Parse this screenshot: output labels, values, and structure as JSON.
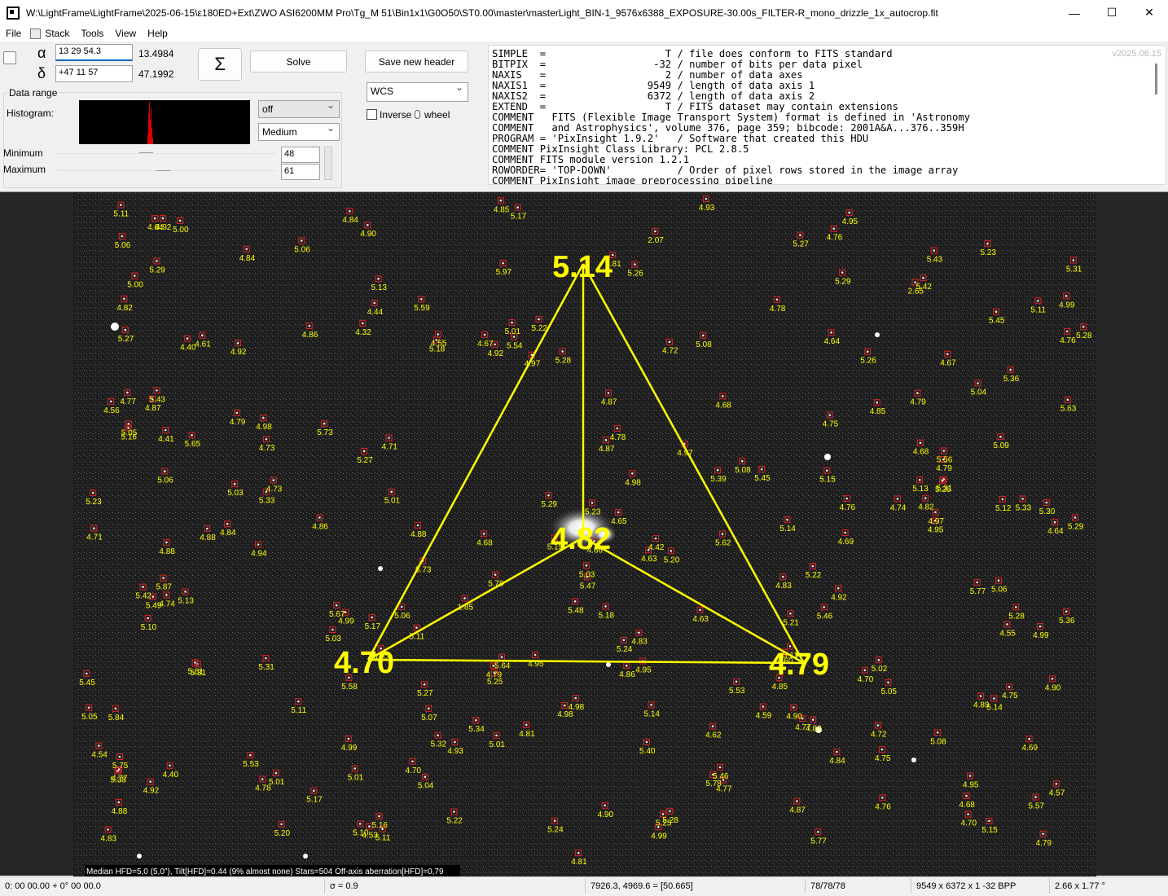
{
  "window": {
    "title": "W:\\LightFrame\\LightFrame\\2025-06-15\\ε180ED+Ext\\ZWO ASI6200MM Pro\\Tg_M 51\\Bin1x1\\G0O50\\ST0.00\\master\\masterLight_BIN-1_9576x6388_EXPOSURE-30.00s_FILTER-R_mono_drizzle_1x_autocrop.fit",
    "minimize": "—",
    "maximize": "☐",
    "close": "✕"
  },
  "menu": {
    "file": "File",
    "stack": "Stack",
    "tools": "Tools",
    "view": "View",
    "help": "Help"
  },
  "coords": {
    "alpha_symbol": "α",
    "delta_symbol": "δ",
    "ra_input": "13 29 54.3",
    "dec_input": "+47 11 57",
    "ra_decimal": "13.4984",
    "dec_decimal": "47.1992"
  },
  "buttons": {
    "sigma": "Σ",
    "solve": "Solve",
    "save_header": "Save new header"
  },
  "wcs_select": "WCS",
  "inverse_label": "Inverse",
  "wheel_label": "wheel",
  "data_range": {
    "group_label": "Data range",
    "histogram_label": "Histogram:",
    "stretch_select": "off",
    "level_select": "Medium",
    "minimum_label": "Minimum",
    "maximum_label": "Maximum",
    "minimum_value": "48",
    "maximum_value": "61"
  },
  "version": "v2025.06.15",
  "header_lines": [
    "SIMPLE  =                    T / file does conform to FITS standard",
    "BITPIX  =                  -32 / number of bits per data pixel",
    "NAXIS   =                    2 / number of data axes",
    "NAXIS1  =                 9549 / length of data axis 1",
    "NAXIS2  =                 6372 / length of data axis 2",
    "EXTEND  =                    T / FITS dataset may contain extensions",
    "COMMENT   FITS (Flexible Image Transport System) format is defined in 'Astronomy",
    "COMMENT   and Astrophysics', volume 376, page 359; bibcode: 2001A&A...376..359H",
    "PROGRAM = 'PixInsight 1.9.2'   / Software that created this HDU",
    "COMMENT PixInsight Class Library: PCL 2.8.5",
    "COMMENT FITS module version 1.2.1",
    "ROWORDER= 'TOP-DOWN'           / Order of pixel rows stored in the image array",
    "COMMENT PixInsight image preprocessing pipeline"
  ],
  "tilt": {
    "top": "5.14",
    "center": "4.82",
    "left": "4.70",
    "right": "4.79"
  },
  "hfd_labels": [
    "5.73",
    "5.31",
    "5.43",
    "5.32",
    "5.28",
    "5.30",
    "5.15",
    "5.17",
    "5.53",
    "5.06",
    "5.81",
    "5.84",
    "5.62",
    "5.63",
    "5.77",
    "5.48",
    "5.36",
    "5.49",
    "5.61",
    "5.56",
    "5.45",
    "5.42",
    "5.57",
    "5.46",
    "5.28",
    "5.20",
    "5.04",
    "5.36",
    "5.13",
    "5.14",
    "4.99",
    "5.13",
    "5.47",
    "5.64",
    "5.65",
    "5.78",
    "5.53",
    "5.58",
    "5.25",
    "5.31",
    "5.46",
    "5.33",
    "5.29",
    "5.26",
    "5.27",
    "5.13",
    "5.07",
    "5.38",
    "5.33",
    "5.18",
    "5.26",
    "5.23",
    "5.14",
    "5.08",
    "5.26",
    "5.27",
    "5.25",
    "5.05",
    "5.29",
    "5.16",
    "5.31",
    "4.98",
    "5.59",
    "5.11",
    "5.67",
    "4.88",
    "5.28",
    "5.24",
    "5.22",
    "5.01",
    "4.93",
    "5.15",
    "4.83",
    "5.06",
    "5.01",
    "4.90",
    "5.05",
    "5.29",
    "5.10",
    "5.28",
    "5.42",
    "5.75",
    "2.65",
    "5.21",
    "5.23",
    "5.34",
    "5.73",
    "5.20",
    "5.03",
    "4.82",
    "4.99",
    "4.98",
    "5.09",
    "5.17",
    "4.85",
    "4.90",
    "4.77",
    "4.81",
    "4.95",
    "4.79",
    "4.87",
    "5.11",
    "4.95",
    "5.06",
    "5.08",
    "5.02",
    "5.11",
    "5.18",
    "5.15",
    "5.14",
    "5.87",
    "5.03",
    "5.16",
    "5.39",
    "5.29",
    "4.64",
    "5.23",
    "4.97",
    "4.99",
    "5.06",
    "4.78",
    "5.00",
    "4.63",
    "5.00",
    "4.95",
    "4.92",
    "5.04",
    "5.01",
    "5.12",
    "5.77",
    "5.10",
    "5.79",
    "4.95",
    "5.22",
    "5.17",
    "5.03",
    "4.83",
    "4.90",
    "4.95",
    "5.11",
    "4.94",
    "4.76",
    "4.89",
    "4.64",
    "4.68",
    "4.77",
    "4.85",
    "4.70",
    "4.92",
    "4.79",
    "5.06",
    "4.88",
    "4.93",
    "4.87",
    "4.75",
    "4.82",
    "4.79",
    "5.24",
    "5.22",
    "4.99",
    "4.78",
    "4.73",
    "4.74",
    "4.72",
    "4.72",
    "4.83",
    "4.40",
    "4.57",
    "4.64",
    "4.90",
    "4.59",
    "5.40",
    "5.11",
    "5.27",
    "4.98",
    "5.08",
    "4.68",
    "4.68",
    "4.92",
    "4.92",
    "4.79",
    "4.65",
    "5.97",
    "4.78",
    "4.88",
    "4.76",
    "4.82",
    "4.99",
    "4.67",
    "4.84",
    "4.32",
    "4.87",
    "4.76",
    "4.66",
    "4.71",
    "4.76",
    "4.53",
    "4.68",
    "4.81",
    "4.69",
    "4.55",
    "4.70",
    "4.74",
    "5.01",
    "4.97",
    "4.86",
    "4.85",
    "4.77",
    "4.87",
    "4.77",
    "4.70",
    "4.56",
    "4.44",
    "4.55",
    "4.41",
    "4.67",
    "4.60",
    "4.54",
    "4.40",
    "4.84",
    "4.84",
    "4.71",
    "4.83",
    "5.31",
    "5.43",
    "5.45",
    "5.54",
    "5.05",
    "5.01",
    "5.11",
    "4.86",
    "4.63",
    "4.98",
    "4.84",
    "2.07",
    "4.69",
    "4.75",
    "4.62",
    "4.73",
    "4.88",
    "4.61",
    "4.79",
    "4.42",
    "1.85",
    "5.45",
    "5.27",
    "4.75",
    "4.92",
    "4.97",
    "4.86"
  ],
  "overlay_status": "Median HFD=5,0 (5,0\"),  Tilt[HFD]=0.44 (9% almost none)  Stars=504  Off-axis aberration[HFD]=0,79",
  "statusbar": {
    "position": "0: 00  00.00   + 0° 00  00.0",
    "sigma": "σ = 0.9",
    "pixel": "7926.3, 4969.6 = [50.665]",
    "rgb": "78/78/78",
    "dimensions": "9549 x 6372 x 1   -32 BPP",
    "scale": "2.66 x 1.77 °"
  },
  "colors": {
    "annotation": "#ffff00",
    "star_box": "#e02020",
    "sky_bg": "#1a1a1a"
  }
}
